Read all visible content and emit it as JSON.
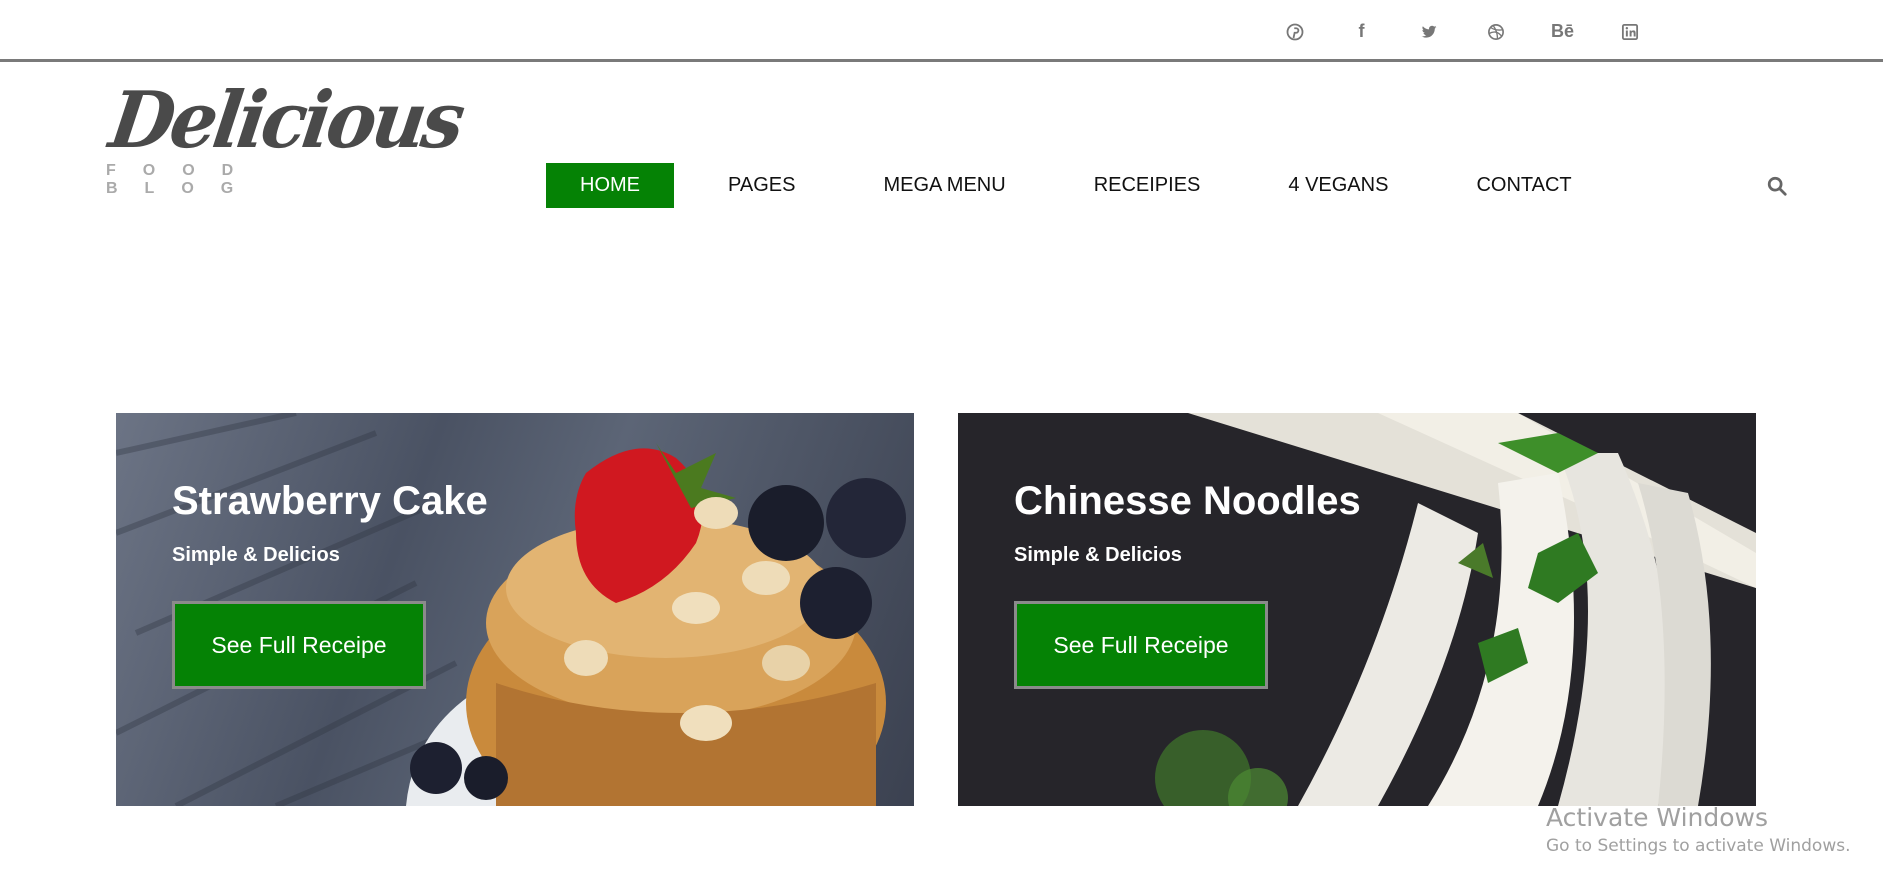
{
  "social": {
    "items": [
      {
        "icon": "pinterest-icon"
      },
      {
        "icon": "facebook-icon",
        "glyph": "f"
      },
      {
        "icon": "twitter-icon"
      },
      {
        "icon": "dribbble-icon"
      },
      {
        "icon": "behance-icon",
        "glyph": "Bē"
      },
      {
        "icon": "linkedin-icon"
      }
    ]
  },
  "logo": {
    "script": "Delicious",
    "tagline": "FOOD BLOG"
  },
  "nav": {
    "items": [
      {
        "label": "HOME",
        "active": true
      },
      {
        "label": "PAGES"
      },
      {
        "label": "MEGA MENU"
      },
      {
        "label": "RECEIPIES"
      },
      {
        "label": "4 VEGANS"
      },
      {
        "label": "CONTACT"
      }
    ],
    "search_icon": "search-icon"
  },
  "cards": [
    {
      "title": "Strawberry Cake",
      "subtitle": "Simple & Delicios",
      "button": "See Full Receipe"
    },
    {
      "title": "Chinesse Noodles",
      "subtitle": "Simple & Delicios",
      "button": "See Full Receipe"
    }
  ],
  "colors": {
    "accent": "#058205",
    "divider": "#7a7a7a",
    "nav_text": "#111111"
  },
  "watermark": {
    "title": "Activate Windows",
    "subtitle": "Go to Settings to activate Windows."
  }
}
